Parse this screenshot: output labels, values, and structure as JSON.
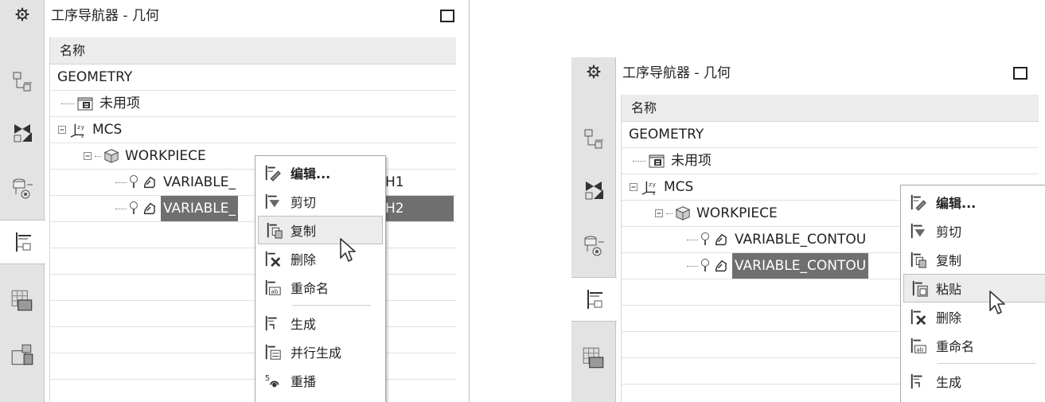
{
  "left": {
    "title": "工序导航器 - 几何",
    "column_header": "名称",
    "tree": [
      {
        "label": "GEOMETRY"
      },
      {
        "label": "未用项"
      },
      {
        "label": "MCS"
      },
      {
        "label": "WORKPIECE"
      },
      {
        "label": "VARIABLE_",
        "tail": "H1"
      },
      {
        "label": "VARIABLE_",
        "tail": "H2",
        "selected": true
      }
    ],
    "menu": [
      {
        "label": "编辑...",
        "icon": "edit-icon"
      },
      {
        "label": "剪切",
        "icon": "cut-icon"
      },
      {
        "label": "复制",
        "icon": "copy-icon",
        "highlighted": true
      },
      {
        "label": "删除",
        "icon": "delete-icon"
      },
      {
        "label": "重命名",
        "icon": "rename-icon"
      },
      {
        "label": "生成",
        "icon": "generate-icon"
      },
      {
        "label": "并行生成",
        "icon": "parallel-generate-icon"
      },
      {
        "label": "重播",
        "icon": "replay-icon"
      }
    ]
  },
  "right": {
    "title": "工序导航器 - 几何",
    "column_header": "名称",
    "tree": [
      {
        "label": "GEOMETRY"
      },
      {
        "label": "未用项"
      },
      {
        "label": "MCS"
      },
      {
        "label": "WORKPIECE"
      },
      {
        "label": "VARIABLE_CONTOU"
      },
      {
        "label": "VARIABLE_CONTOU",
        "selected": true
      }
    ],
    "menu": [
      {
        "label": "编辑...",
        "icon": "edit-icon"
      },
      {
        "label": "剪切",
        "icon": "cut-icon"
      },
      {
        "label": "复制",
        "icon": "copy-icon"
      },
      {
        "label": "粘贴",
        "icon": "paste-icon",
        "highlighted": true
      },
      {
        "label": "删除",
        "icon": "delete-icon"
      },
      {
        "label": "重命名",
        "icon": "rename-icon"
      },
      {
        "label": "生成",
        "icon": "generate-icon"
      }
    ]
  },
  "colors": {
    "selection": "#6f6f6f",
    "resource_bar": "#e3e3e3",
    "menu_highlight": "#ececec"
  }
}
